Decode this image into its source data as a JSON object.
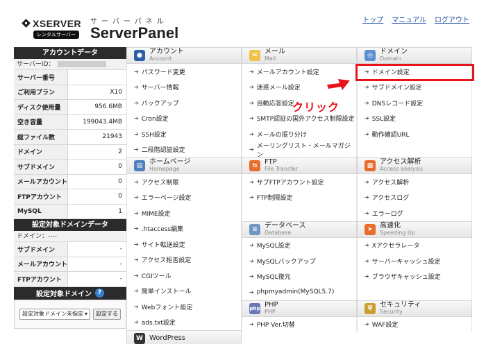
{
  "header": {
    "logo_text": "XSERVER",
    "logo_badge": "レンタルサーバー",
    "panel_sub": "サーバーパネル",
    "panel_title": "ServerPanel",
    "links": [
      "トップ",
      "マニュアル",
      "ログアウト"
    ]
  },
  "sidebar": {
    "account_heading": "アカウントデータ",
    "server_id_label": "サーバーID：",
    "rows": [
      {
        "label": "サーバー番号",
        "value": ""
      },
      {
        "label": "ご利用プラン",
        "value": "X10"
      },
      {
        "label": "ディスク使用量",
        "value": "956.6MB"
      },
      {
        "label": "空き容量",
        "value": "199043.4MB"
      },
      {
        "label": "総ファイル数",
        "value": "21943"
      },
      {
        "label": "ドメイン",
        "value": "2"
      },
      {
        "label": "サブドメイン",
        "value": "0"
      },
      {
        "label": "メールアカウント",
        "value": "0"
      },
      {
        "label": "FTPアカウント",
        "value": "0"
      },
      {
        "label": "MySQL",
        "value": "1"
      }
    ],
    "domain_heading": "設定対象ドメインデータ",
    "domain_label": "ドメイン：----",
    "domain_rows": [
      {
        "label": "サブドメイン",
        "value": "-"
      },
      {
        "label": "メールアカウント",
        "value": "-"
      },
      {
        "label": "FTPアカウント",
        "value": "-"
      }
    ],
    "target_heading": "設定対象ドメイン",
    "select_value": "設定対象ドメイン未指定",
    "set_button": "設定する"
  },
  "columns": {
    "account": {
      "title": "アカウント",
      "en": "Account",
      "items": [
        "パスワード変更",
        "サーバー情報",
        "バックアップ",
        "Cron設定",
        "SSH設定",
        "二段階認証設定"
      ]
    },
    "homepage": {
      "title": "ホームページ",
      "en": "Homepage",
      "items": [
        "アクセス制限",
        "エラーページ設定",
        "MIME設定",
        ".htaccess編集",
        "サイト転送設定",
        "アクセス拒否設定",
        "CGIツール",
        "簡単インストール",
        "Webフォント設定",
        "ads.txt設定"
      ]
    },
    "wordpress": {
      "title": "WordPress"
    },
    "mail": {
      "title": "メール",
      "en": "Mail",
      "items": [
        "メールアカウント設定",
        "迷惑メール設定",
        "自動応答設定",
        "SMTP認証の国外アクセス制限設定",
        "メールの振り分け",
        "メーリングリスト・メールマガジン"
      ]
    },
    "ftp": {
      "title": "FTP",
      "en": "File Transfer",
      "items": [
        "サブFTPアカウント設定",
        "FTP制限設定"
      ]
    },
    "database": {
      "title": "データベース",
      "en": "Database",
      "items": [
        "MySQL設定",
        "MySQLバックアップ",
        "MySQL復元",
        "phpmyadmin(MySQL5.7)"
      ]
    },
    "php": {
      "title": "PHP",
      "en": "PHP",
      "items": [
        "PHP Ver.切替"
      ]
    },
    "domain": {
      "title": "ドメイン",
      "en": "Domain",
      "items": [
        "ドメイン設定",
        "サブドメイン設定",
        "DNSレコード設定",
        "SSL設定",
        "動作確認URL"
      ]
    },
    "analytics": {
      "title": "アクセス解析",
      "en": "Access analysis",
      "items": [
        "アクセス解析",
        "アクセスログ",
        "エラーログ"
      ]
    },
    "speed": {
      "title": "高速化",
      "en": "Speeding Up",
      "items": [
        "Xアクセラレータ",
        "サーバーキャッシュ設定",
        "ブラウザキャッシュ設定"
      ]
    },
    "security": {
      "title": "セキュリティ",
      "en": "Security",
      "items": [
        "WAF設定"
      ]
    }
  },
  "annotation": {
    "click_label": "クリック",
    "color": "#e8141b"
  }
}
